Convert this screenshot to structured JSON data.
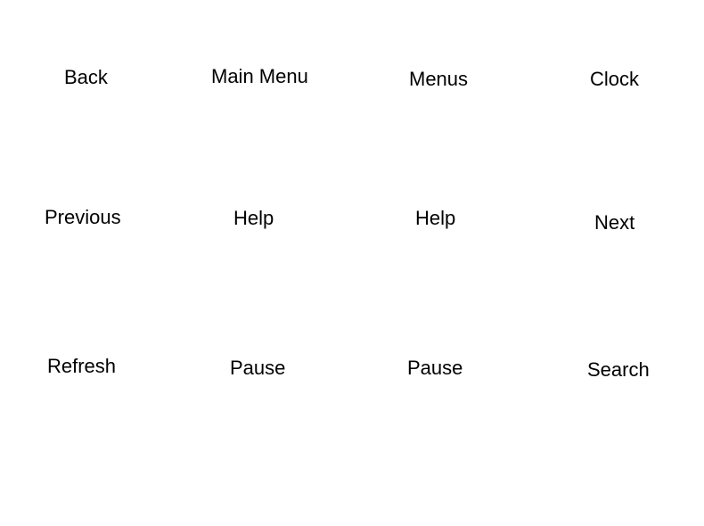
{
  "buttons": {
    "back": "Back",
    "main_menu": "Main Menu",
    "menus": "Menus",
    "clock": "Clock",
    "previous": "Previous",
    "help_1": "Help",
    "help_2": "Help",
    "next": "Next",
    "refresh": "Refresh",
    "pause_1": "Pause",
    "pause_2": "Pause",
    "search": "Search"
  }
}
